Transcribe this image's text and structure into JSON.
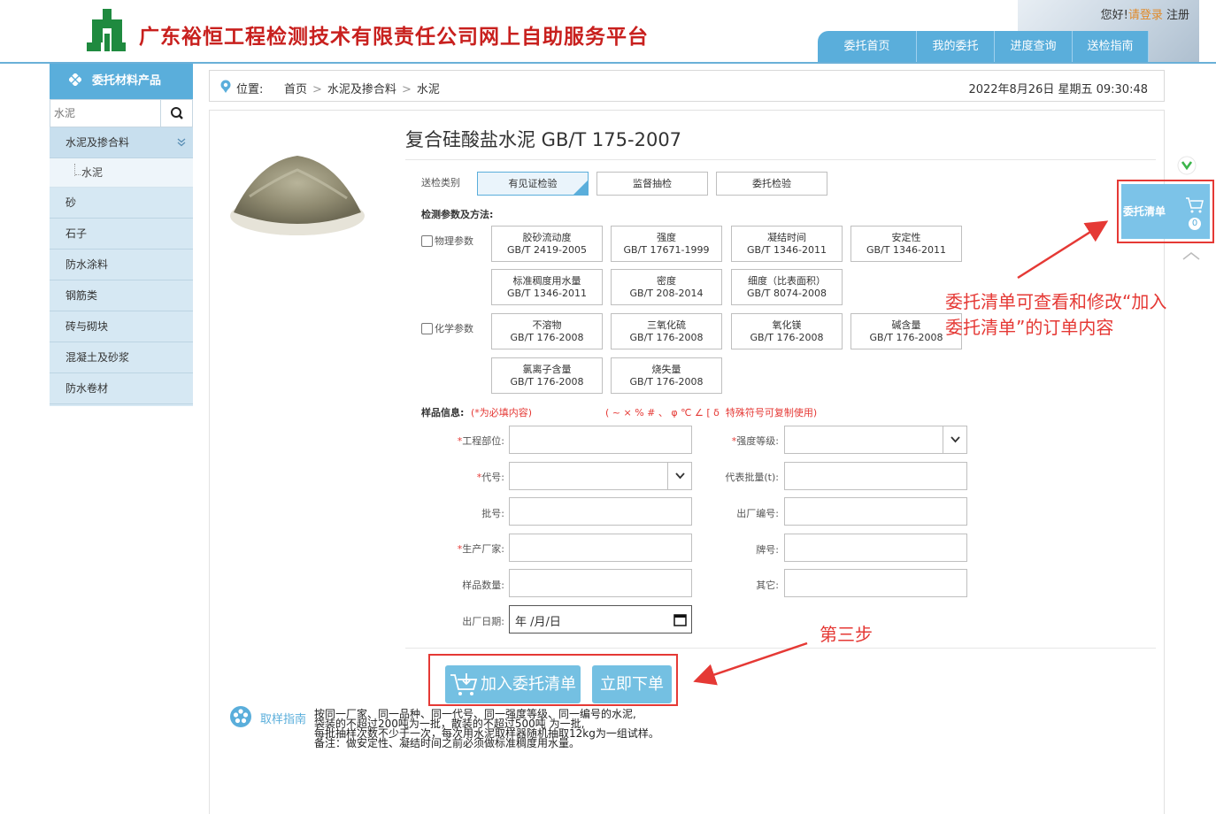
{
  "header": {
    "site_title": "广东裕恒工程检测技术有限责任公司网上自助服务平台",
    "greeting": "您好!",
    "login": "请登录",
    "register": "注册",
    "nav": [
      "委托首页",
      "我的委托",
      "进度查询",
      "送检指南"
    ]
  },
  "sidebar": {
    "title": "委托材料产品",
    "search_placeholder": "水泥",
    "items": [
      {
        "label": "水泥及掺合料",
        "expanded": true,
        "children": [
          "水泥"
        ]
      },
      {
        "label": "砂"
      },
      {
        "label": "石子"
      },
      {
        "label": "防水涂料"
      },
      {
        "label": "钢筋类"
      },
      {
        "label": "砖与砌块"
      },
      {
        "label": "混凝土及砂浆"
      },
      {
        "label": "防水卷材"
      }
    ]
  },
  "breadcrumb": {
    "label": "位置:",
    "path": [
      "首页",
      "水泥及掺合料",
      "水泥"
    ],
    "datetime": "2022年8月26日 星期五 09:30:48"
  },
  "product": {
    "title": "复合硅酸盐水泥 GB/T 175-2007",
    "inspect_type_label": "送检类别",
    "inspect_types": [
      "有见证检验",
      "监督抽检",
      "委托检验"
    ],
    "params_label": "检测参数及方法:",
    "physical_label": "物理参数",
    "physical_params": [
      {
        "name": "胶砂流动度",
        "std": "GB/T 2419-2005"
      },
      {
        "name": "强度",
        "std": "GB/T 17671-1999"
      },
      {
        "name": "凝结时间",
        "std": "GB/T 1346-2011"
      },
      {
        "name": "安定性",
        "std": "GB/T 1346-2011"
      },
      {
        "name": "标准稠度用水量",
        "std": "GB/T 1346-2011"
      },
      {
        "name": "密度",
        "std": "GB/T 208-2014"
      },
      {
        "name": "细度（比表面积）",
        "std": "GB/T 8074-2008"
      }
    ],
    "chemical_label": "化学参数",
    "chemical_params": [
      {
        "name": "不溶物",
        "std": "GB/T 176-2008"
      },
      {
        "name": "三氧化硫",
        "std": "GB/T 176-2008"
      },
      {
        "name": "氧化镁",
        "std": "GB/T 176-2008"
      },
      {
        "name": "碱含量",
        "std": "GB/T 176-2008"
      },
      {
        "name": "氯离子含量",
        "std": "GB/T 176-2008"
      },
      {
        "name": "烧失量",
        "std": "GB/T 176-2008"
      }
    ]
  },
  "sample": {
    "label": "样品信息:",
    "required_note": "(*为必填内容)",
    "symbols_note": "( ~ × % # 、 φ ℃ ∠ [ δ  特殊符号可复制使用)",
    "fields": {
      "project_part": "工程部位:",
      "strength_grade": "强度等级:",
      "code": "代号:",
      "batch_qty": "代表批量(t):",
      "batch_no": "批号:",
      "factory_no": "出厂编号:",
      "manufacturer": "生产厂家:",
      "brand": "牌号:",
      "sample_qty": "样品数量:",
      "other": "其它:",
      "factory_date": "出厂日期:"
    },
    "date_placeholder": "年 /月/日"
  },
  "actions": {
    "add_to_list": "加入委托清单",
    "order_now": "立即下单"
  },
  "guide": {
    "label": "取样指南",
    "lines": [
      "按同一厂家、同一品种、同一代号、同一强度等级、同一编号的水泥,",
      "袋装的不超过200吨为一批，散装的不超过500吨 为一批,",
      "每批抽样次数不少于一次，每次用水泥取样器随机抽取12kg为一组试样。",
      "备注：做安定性、凝结时间之前必须做标准稠度用水量。"
    ]
  },
  "cart": {
    "label": "委托清单",
    "count": "0"
  },
  "annotations": {
    "cart_note": "委托清单可查看和修改“加入委托清单”的订单内容",
    "step": "第三步"
  },
  "colors": {
    "brand_red": "#c8201e",
    "primary_blue": "#5aaedb",
    "annotation_red": "#e53935"
  }
}
